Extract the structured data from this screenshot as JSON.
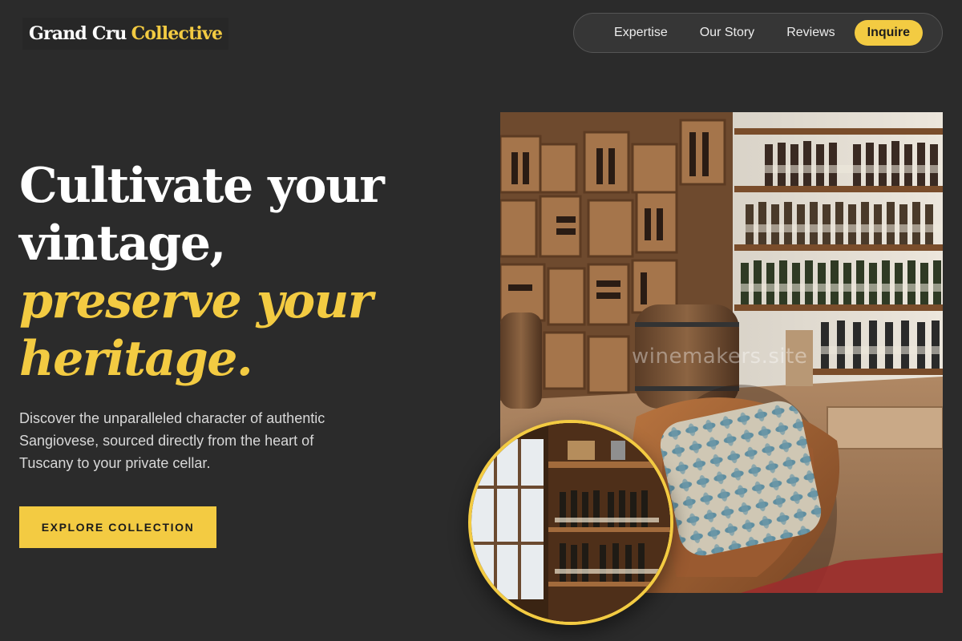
{
  "brand": {
    "name_part1": "Grand Cru",
    "name_part2": "Collective"
  },
  "nav": {
    "links": [
      "Expertise",
      "Our Story",
      "Reviews"
    ],
    "cta": "Inquire"
  },
  "hero": {
    "headline_line1": "Cultivate your",
    "headline_line2": "vintage,",
    "headline_line3": "preserve your",
    "headline_line4": "heritage.",
    "description": "Discover the unparalleled character of authentic Sangiovese, sourced directly from the heart of Tuscany to your private cellar.",
    "button_label": "EXPLORE COLLECTION"
  },
  "images": {
    "main_photo_watermark": "winemakers.site",
    "main_photo_icon": "wine-cellar-photo-icon",
    "inset_photo_icon": "wine-shelf-photo-icon"
  },
  "colors": {
    "background": "#2b2b2b",
    "accent": "#f3cb42",
    "text": "#ffffff",
    "muted_text": "#d8d8d8"
  }
}
